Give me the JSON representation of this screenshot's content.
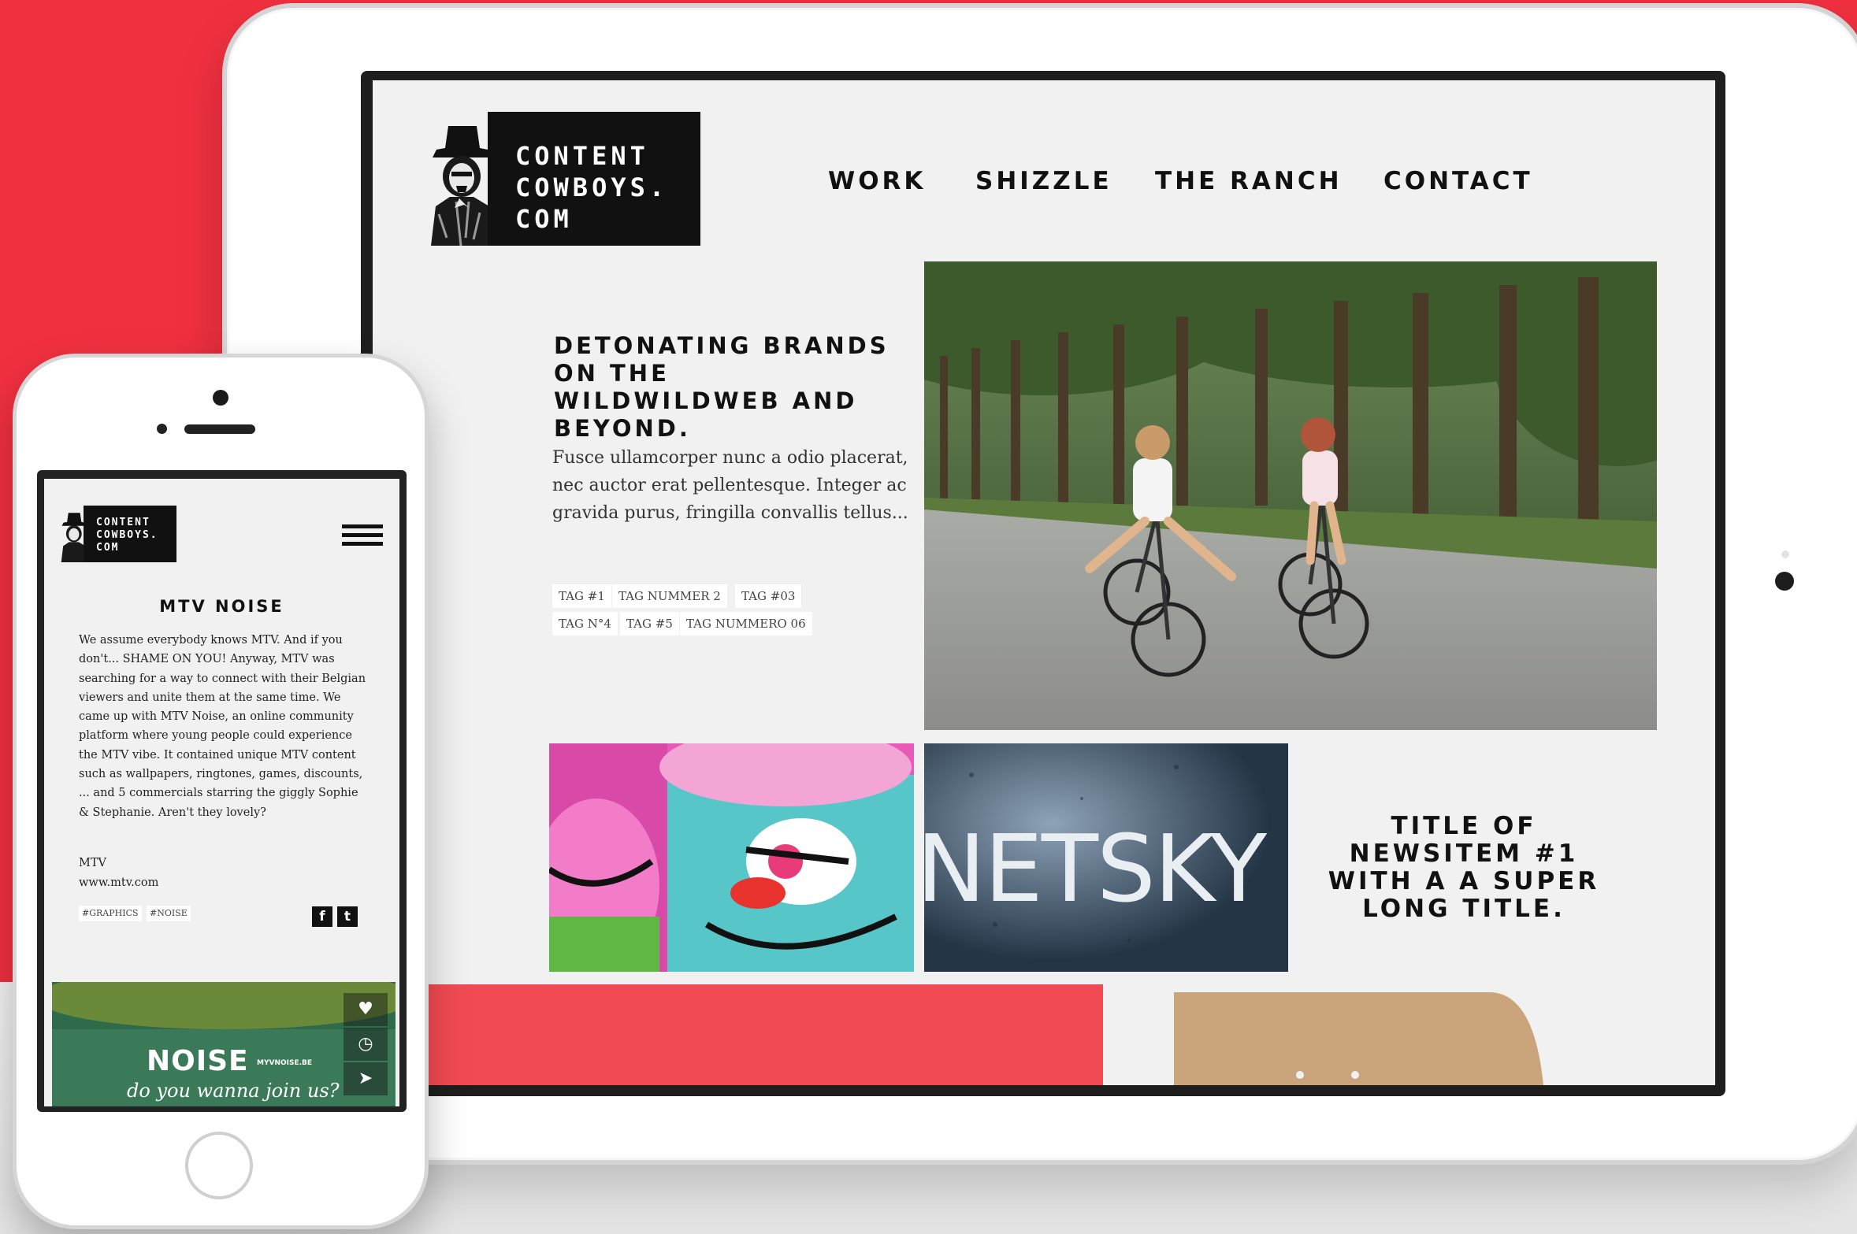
{
  "colors": {
    "background_red": "#f0303f",
    "page_bg": "#f1f1f1",
    "logo_black": "#111111"
  },
  "tablet": {
    "logo_lines": [
      "CONTENT",
      "COWBOYS.",
      "COM"
    ],
    "nav": [
      "WORK",
      "SHIZZLE",
      "THE RANCH",
      "CONTACT"
    ],
    "headline": "DETONATING BRANDS ON THE WILDWILDWEB AND BEYOND.",
    "intro": "Fusce ullamcorper nunc a odio placerat, nec auctor erat pellentesque. Integer ac gravida purus, fringilla convallis tellus...",
    "tags": [
      "TAG #1",
      "TAG NUMMER 2",
      "TAG #03",
      "TAG N°4",
      "TAG #5",
      "TAG NUMMERO 06"
    ],
    "tile_text": "NETSKY",
    "news_title": "TITLE OF NEWSITEM #1 WITH A A SUPER LONG TITLE."
  },
  "phone": {
    "logo_lines": [
      "CONTENT",
      "COWBOYS.",
      "COM"
    ],
    "title": "MTV NOISE",
    "body": "We assume everybody knows MTV. And if you don't... SHAME ON YOU! Anyway, MTV was searching for a way to connect with their Belgian viewers and unite them at the same time. We came up with MTV Noise, an online community platform where young people could experience the MTV vibe. It contained unique MTV content such as wallpapers, ringtones, games, discounts, ... and 5 commercials starring the giggly Sophie & Stephanie. Aren't they lovely?",
    "client": "MTV",
    "url": "www.mtv.com",
    "tags": [
      "#GRAPHICS",
      "#NOISE"
    ],
    "social": [
      "f",
      "t"
    ],
    "feature_title": "NOISE",
    "feature_site": "MYVNOISE.BE",
    "feature_tagline": "do you wanna join us?",
    "side_icons": [
      "heart-icon",
      "clock-icon",
      "send-icon"
    ]
  }
}
